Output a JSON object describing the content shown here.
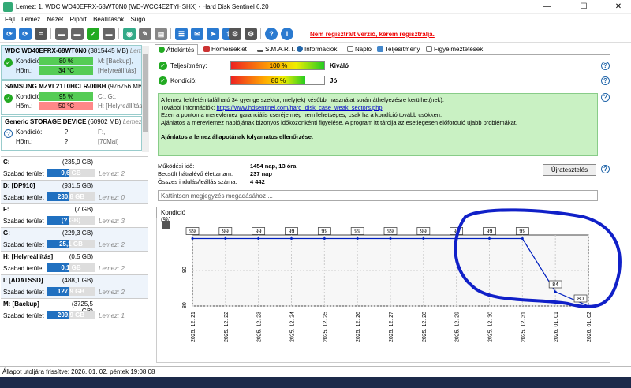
{
  "window": {
    "title": "Lemez: 1, WDC WD40EFRX-68WT0N0 [WD-WCC4E2TYHSHX]  -  Hard Disk Sentinel 6.20",
    "min": "—",
    "max": "☐",
    "close": "✕"
  },
  "menu": [
    "Fájl",
    "Lemez",
    "Nézet",
    "Riport",
    "Beállítások",
    "Súgó"
  ],
  "toolbar": {
    "registration_notice": "Nem regisztrált verzió, kérem regisztrálja."
  },
  "disks": [
    {
      "name": "WDC WD40EFRX-68WT0N0",
      "size": "(3815445 MB)",
      "extra": "Lem",
      "condition_label": "Kondíció:",
      "condition": "80 %",
      "condition_ext": "M: [Backup],",
      "temp_label": "Hőm.:",
      "temp": "34 °C",
      "temp_ext": "[Helyreállítás]"
    },
    {
      "name": "SAMSUNG MZVL21T0HCLR-00BH",
      "size": "(976756 MB",
      "condition_label": "Kondíció:",
      "condition": "95 %",
      "condition_ext": "C:, G:,",
      "temp_label": "Hőm.:",
      "temp": "50 °C",
      "temp_ext": "H: [Helyreállítás"
    },
    {
      "name": "Generic STORAGE DEVICE",
      "size": "(60902 MB)",
      "extra": "Lemez",
      "condition_label": "Kondíció:",
      "condition": "?",
      "condition_ext": "F:,",
      "temp_label": "Hőm.:",
      "temp": "?",
      "temp_ext": "[70Mai]"
    }
  ],
  "partitions": [
    {
      "name": "C:",
      "size": "(235,9 GB)",
      "free_label": "Szabad terület",
      "free": "9,6 GB",
      "free_fraction": 0.04,
      "disk": "Lemez: 2"
    },
    {
      "name": "D: [DP910]",
      "size": "(931,5 GB)",
      "free_label": "Szabad terület",
      "free": "230,8 GB",
      "free_fraction": 0.25,
      "disk": "Lemez: 0"
    },
    {
      "name": "F:",
      "size": "(7 GB)",
      "free_label": "Szabad terület",
      "free": "(? GB)",
      "free_fraction": 0.0,
      "disk": "Lemez: 3"
    },
    {
      "name": "G:",
      "size": "(229,3 GB)",
      "free_label": "Szabad terület",
      "free": "25,1 GB",
      "free_fraction": 0.11,
      "disk": "Lemez: 2"
    },
    {
      "name": "H: [Helyreállítás]",
      "size": "(0,5 GB)",
      "free_label": "Szabad terület",
      "free": "0,1 GB",
      "free_fraction": 0.2,
      "disk": "Lemez: 2"
    },
    {
      "name": "I: [ADATSSD]",
      "size": "(488,1 GB)",
      "free_label": "Szabad terület",
      "free": "127,9 GB",
      "free_fraction": 0.26,
      "disk": "Lemez: 2"
    },
    {
      "name": "M: [Backup]",
      "size": "(3725,5 GB)",
      "free_label": "Szabad terület",
      "free": "209,9 GB",
      "free_fraction": 0.06,
      "disk": "Lemez: 1"
    }
  ],
  "tabs": [
    "Áttekintés",
    "Hőmérséklet",
    "S.M.A.R.T.",
    "Információk",
    "Napló",
    "Teljesítmény",
    "Figyelmeztetések"
  ],
  "performance": {
    "label": "Teljesítmény:",
    "value": "100 %",
    "level": 1.0,
    "rating": "Kiváló"
  },
  "condition": {
    "label": "Kondíció:",
    "value": "80 %",
    "level": 0.8,
    "rating": "Jó"
  },
  "info": {
    "line1": "A lemez felületén található 34 gyenge szektor, mely(ek) későbbi használat során áthelyezésre kerülhet(nek).",
    "line2_prefix": "További információk: ",
    "link": "https://www.hdsentinel.com/hard_disk_case_weak_sectors.php",
    "line3": "Ezen a ponton a merevlemez garanciális cseréje még nem lehetséges, csak ha a kondíció tovább csökken.",
    "line4": "Ajánlatos a merevlemez naplójának bizonyos időközönkénti figyelése. A program itt tárolja az esetlegesen előforduló újabb problémákat.",
    "line5": "Ajánlatos a lemez állapotának folyamatos ellenőrzése."
  },
  "stats": [
    {
      "key": "Működési idő:",
      "value": "1454 nap, 13 óra"
    },
    {
      "key": "Becsült hátralévő élettartam:",
      "value": "237 nap"
    },
    {
      "key": "Összes indulás/leállás száma:",
      "value": "4 442"
    }
  ],
  "reset_button": "Újratesztelés",
  "comment_placeholder": "Kattintson megjegyzés megadásához ...",
  "chart_tab": "Kondíció (%)",
  "chart_data": {
    "type": "line",
    "x": [
      "2025. 12. 21",
      "2025. 12. 22",
      "2025. 12. 23",
      "2025. 12. 24",
      "2025. 12. 25",
      "2025. 12. 26",
      "2025. 12. 27",
      "2025. 12. 28",
      "2025. 12. 29",
      "2025. 12. 30",
      "2025. 12. 31",
      "2026. 01. 01",
      "2026. 01. 02"
    ],
    "series": [
      {
        "values": [
          99,
          99,
          99,
          99,
          99,
          99,
          99,
          99,
          99,
          99,
          99,
          84,
          80
        ]
      }
    ],
    "ylim": [
      80,
      100
    ],
    "yticks": [
      "80",
      "90"
    ],
    "color": "#0020c0"
  },
  "status": "Állapot utoljára frissítve: 2026. 01. 02. péntek 19:08:08"
}
